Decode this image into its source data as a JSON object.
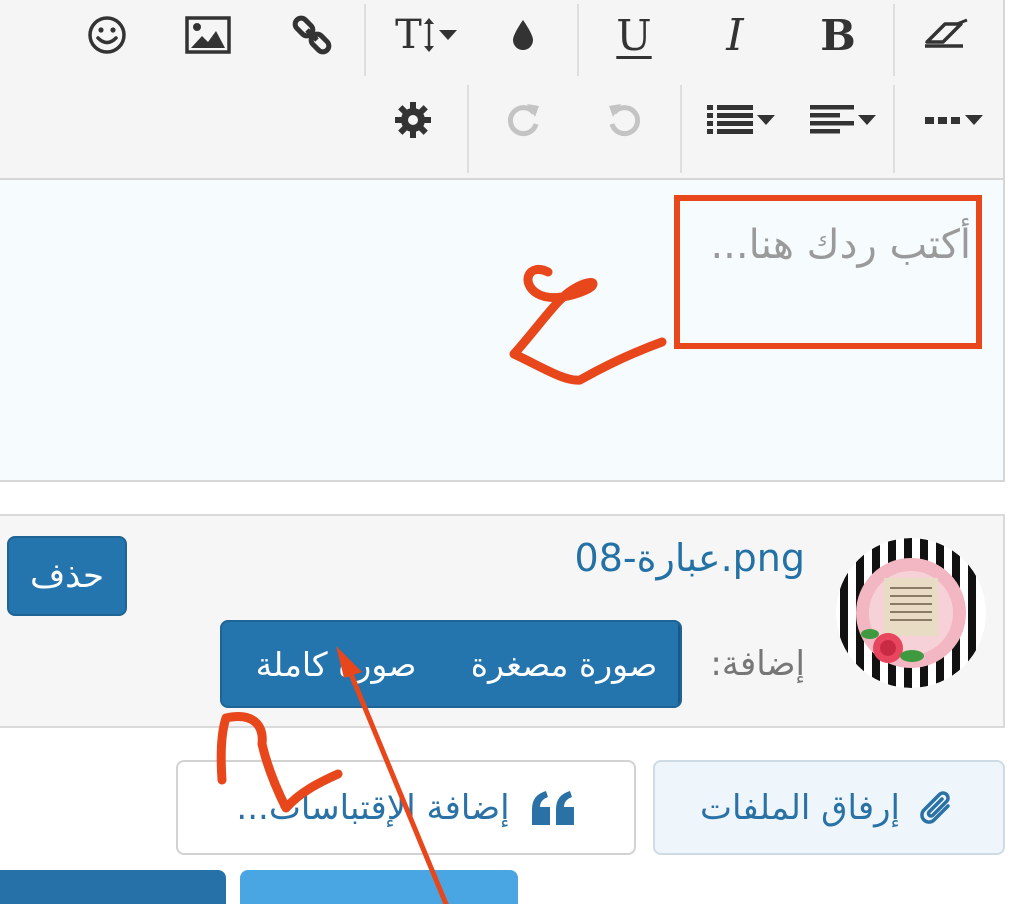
{
  "toolbar": {
    "row1": [
      "smiley-icon",
      "image-icon",
      "link-icon",
      "font-size-icon",
      "color-drop-icon",
      "underline-icon",
      "italic-icon",
      "bold-icon",
      "eraser-icon"
    ],
    "row2": [
      "gear-icon",
      "redo-icon",
      "undo-icon",
      "list-icon",
      "align-icon",
      "more-icon"
    ],
    "underline_glyph": "U",
    "italic_glyph": "I",
    "bold_glyph": "B",
    "font_size_glyph": "T"
  },
  "editor": {
    "placeholder": "أكتب ردك هنا..."
  },
  "attachment": {
    "file_name": "عبارة-08.png",
    "insert_label": "إضافة:",
    "thumbnail_button": "صورة مصغرة",
    "full_image_button": "صورة كاملة",
    "delete_button": "حذف"
  },
  "actions": {
    "attach_files": "إرفاق الملفات",
    "add_quotes": "إضافة الإقتباسات..."
  },
  "colors": {
    "accent": "#2474ad",
    "link": "#2471a6",
    "annotation": "#e8471c"
  }
}
